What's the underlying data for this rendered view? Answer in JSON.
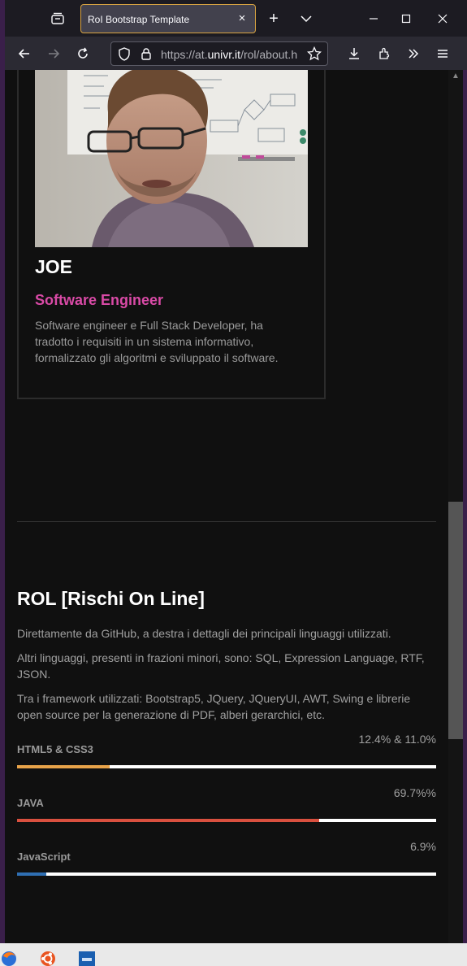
{
  "browser": {
    "tab_title": "RoI Bootstrap Template",
    "url_prefix": "https://at.",
    "url_host": "univr.it",
    "url_path": "/rol/about.h",
    "tab_close_glyph": "×",
    "new_tab_glyph": "+"
  },
  "profile": {
    "name": "JOE",
    "role": "Software Engineer",
    "description": "Software engineer e Full Stack Developer, ha tradotto i requisiti in un sistema informativo, formalizzato gli algoritmi e sviluppato il software."
  },
  "section": {
    "title": "ROL [Rischi On Line]",
    "paragraphs": [
      "Direttamente da GitHub, a destra i dettagli dei principali linguaggi utilizzati.",
      "Altri linguaggi, presenti in frazioni minori, sono: SQL, Expression Language, RTF, JSON.",
      "Tra i framework utilizzati: Bootstrap5, JQuery, JQueryUI, AWT, Swing e librerie open source per la generazione di PDF, alberi gerarchici, etc."
    ]
  },
  "skills": [
    {
      "label": "HTML5 & CSS3",
      "value_text": "12.4% & 11.0%",
      "fraction": 0.22,
      "color": "#e8a34a"
    },
    {
      "label": "JAVA",
      "value_text": "69.7%%",
      "fraction": 0.72,
      "color": "#d9503f"
    },
    {
      "label": "JavaScript",
      "value_text": "6.9%",
      "fraction": 0.07,
      "color": "#2f6fb3"
    }
  ],
  "colors": {
    "accent_role": "#d94aa6",
    "page_bg": "#101010"
  },
  "icons": [
    "tab-list-icon",
    "close-icon",
    "new-tab-icon",
    "chevron-down-icon",
    "minimize-icon",
    "maximize-icon",
    "window-close-icon",
    "back-arrow-icon",
    "forward-arrow-icon",
    "reload-icon",
    "shield-icon",
    "lock-icon",
    "star-icon",
    "download-icon",
    "extensions-icon",
    "overflow-icon",
    "menu-icon",
    "firefox-icon",
    "ubuntu-icon",
    "app-icon"
  ]
}
